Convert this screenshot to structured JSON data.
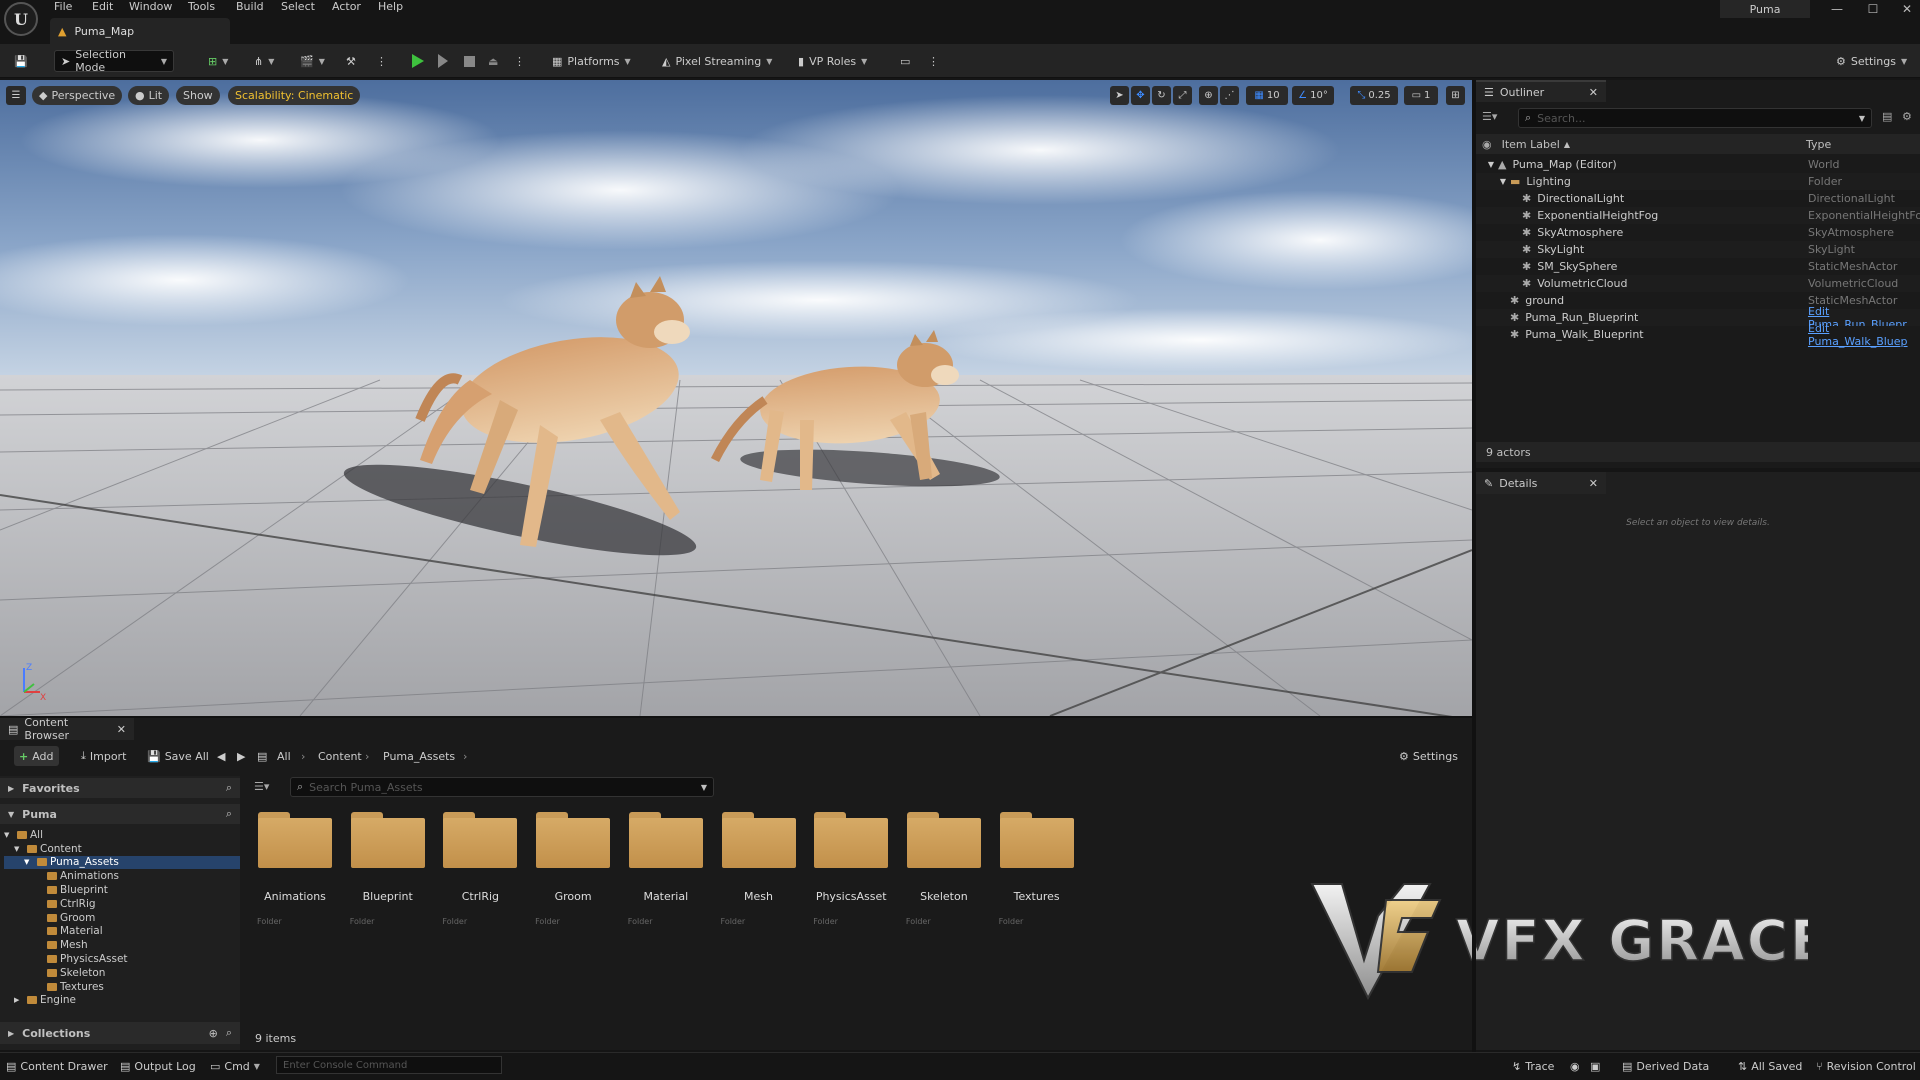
{
  "menu": {
    "items": [
      "File",
      "Edit",
      "Window",
      "Tools",
      "Build",
      "Select",
      "Actor",
      "Help"
    ]
  },
  "doc_tab": {
    "label": "Puma_Map"
  },
  "project_name": "Puma",
  "toolbar": {
    "selection_mode": "Selection Mode",
    "platforms": "Platforms",
    "pixel_streaming": "Pixel Streaming",
    "vp_roles": "VP Roles",
    "settings": "Settings"
  },
  "viewport": {
    "perspective": "Perspective",
    "lit": "Lit",
    "show": "Show",
    "scalability": "Scalability: Cinematic",
    "grid_snap": "10",
    "rotation_snap": "10°",
    "scale_snap": "0.25",
    "camera_speed": "1",
    "axis_z": "Z",
    "axis_x": "X"
  },
  "outliner": {
    "tab": "Outliner",
    "search_placeholder": "Search...",
    "col_label": "Item Label",
    "col_type": "Type",
    "rows": [
      {
        "label": "Puma_Map (Editor)",
        "type": "World",
        "indent": 0,
        "arrow": "▼"
      },
      {
        "label": "Lighting",
        "type": "Folder",
        "indent": 1,
        "arrow": "▼"
      },
      {
        "label": "DirectionalLight",
        "type": "DirectionalLight",
        "indent": 2,
        "arrow": ""
      },
      {
        "label": "ExponentialHeightFog",
        "type": "ExponentialHeightFog",
        "indent": 2,
        "arrow": ""
      },
      {
        "label": "SkyAtmosphere",
        "type": "SkyAtmosphere",
        "indent": 2,
        "arrow": ""
      },
      {
        "label": "SkyLight",
        "type": "SkyLight",
        "indent": 2,
        "arrow": ""
      },
      {
        "label": "SM_SkySphere",
        "type": "StaticMeshActor",
        "indent": 2,
        "arrow": ""
      },
      {
        "label": "VolumetricCloud",
        "type": "VolumetricCloud",
        "indent": 2,
        "arrow": ""
      },
      {
        "label": "ground",
        "type": "StaticMeshActor",
        "indent": 1,
        "arrow": ""
      },
      {
        "label": "Puma_Run_Blueprint",
        "type": "Edit Puma_Run_Bluepr",
        "indent": 1,
        "arrow": "",
        "link": true
      },
      {
        "label": "Puma_Walk_Blueprint",
        "type": "Edit Puma_Walk_Bluep",
        "indent": 1,
        "arrow": "",
        "link": true
      }
    ],
    "actor_count": "9 actors"
  },
  "details": {
    "tab": "Details",
    "empty_message": "Select an object to view details."
  },
  "content_browser": {
    "tab": "Content Browser",
    "add": "Add",
    "import": "Import",
    "save_all": "Save All",
    "breadcrumb": [
      "All",
      "Content",
      "Puma_Assets"
    ],
    "settings": "Settings",
    "favorites": "Favorites",
    "puma": "Puma",
    "collections": "Collections",
    "search_placeholder": "Search Puma_Assets",
    "tree": [
      {
        "label": "All",
        "indent": 0,
        "arrow": "▼",
        "selected": false
      },
      {
        "label": "Content",
        "indent": 1,
        "arrow": "▼",
        "selected": false
      },
      {
        "label": "Puma_Assets",
        "indent": 2,
        "arrow": "▼",
        "selected": true
      },
      {
        "label": "Animations",
        "indent": 3,
        "arrow": "",
        "selected": false
      },
      {
        "label": "Blueprint",
        "indent": 3,
        "arrow": "",
        "selected": false
      },
      {
        "label": "CtrlRig",
        "indent": 3,
        "arrow": "",
        "selected": false
      },
      {
        "label": "Groom",
        "indent": 3,
        "arrow": "",
        "selected": false
      },
      {
        "label": "Material",
        "indent": 3,
        "arrow": "",
        "selected": false
      },
      {
        "label": "Mesh",
        "indent": 3,
        "arrow": "",
        "selected": false
      },
      {
        "label": "PhysicsAsset",
        "indent": 3,
        "arrow": "",
        "selected": false
      },
      {
        "label": "Skeleton",
        "indent": 3,
        "arrow": "",
        "selected": false
      },
      {
        "label": "Textures",
        "indent": 3,
        "arrow": "",
        "selected": false
      },
      {
        "label": "Engine",
        "indent": 1,
        "arrow": "▶",
        "selected": false
      }
    ],
    "folders": [
      {
        "name": "Animations",
        "type": "Folder"
      },
      {
        "name": "Blueprint",
        "type": "Folder"
      },
      {
        "name": "CtrlRig",
        "type": "Folder"
      },
      {
        "name": "Groom",
        "type": "Folder"
      },
      {
        "name": "Material",
        "type": "Folder"
      },
      {
        "name": "Mesh",
        "type": "Folder"
      },
      {
        "name": "PhysicsAsset",
        "type": "Folder"
      },
      {
        "name": "Skeleton",
        "type": "Folder"
      },
      {
        "name": "Textures",
        "type": "Folder"
      }
    ],
    "item_count": "9 items"
  },
  "watermark": {
    "text": "VFX GRACE"
  },
  "status": {
    "content_drawer": "Content Drawer",
    "output_log": "Output Log",
    "cmd": "Cmd",
    "console_placeholder": "Enter Console Command",
    "trace": "Trace",
    "derived_data": "Derived Data",
    "all_saved": "All Saved",
    "revision_control": "Revision Control"
  },
  "colors": {
    "accent_green": "#3ec13e",
    "scalability_text": "#f0c030",
    "link_blue": "#5aa0ff",
    "folder": "#c99b58"
  }
}
